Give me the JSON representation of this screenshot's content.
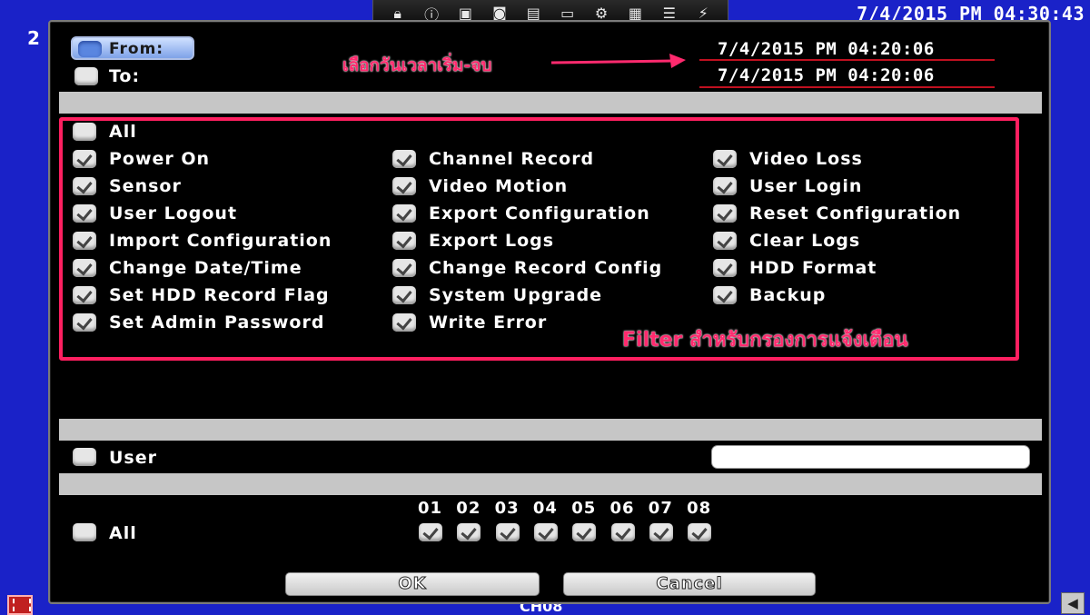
{
  "background": {
    "clock": "7/4/2015 PM 04:30:43",
    "left_digit": "2",
    "channel": "CH08"
  },
  "toolbar": {
    "icons": [
      "lock-icon",
      "info-icon",
      "chat-icon",
      "camera-icon",
      "film-icon",
      "monitor-icon",
      "gears-icon",
      "image-icon",
      "list-icon",
      "network-icon"
    ]
  },
  "time_range": {
    "from_label": "From:",
    "to_label": "To:",
    "from_value": "7/4/2015 PM 04:20:06",
    "to_value": "7/4/2015 PM 04:20:06",
    "annotation": "เลือกวันเวลาเริ่ม-จบ"
  },
  "filter": {
    "all_label": "All",
    "annotation": "Filter สำหรับกรองการแจ้งเตือน",
    "columns": [
      [
        "Power On",
        "Sensor",
        "User Logout",
        "Import Configuration",
        "Change Date/Time",
        "Set HDD Record Flag",
        "Set Admin Password"
      ],
      [
        "Channel Record",
        "Video Motion",
        "Export Configuration",
        "Export Logs",
        "Change Record Config",
        "System Upgrade",
        "Write Error"
      ],
      [
        "Video Loss",
        "User Login",
        "Reset Configuration",
        "Clear Logs",
        "HDD Format",
        "Backup"
      ]
    ]
  },
  "user": {
    "label": "User",
    "value": ""
  },
  "channels": {
    "all_label": "All",
    "numbers": [
      "01",
      "02",
      "03",
      "04",
      "05",
      "06",
      "07",
      "08"
    ]
  },
  "buttons": {
    "ok": "OK",
    "cancel": "Cancel"
  },
  "colors": {
    "desktop": "#1a22c8",
    "dialog": "#000000",
    "annotation": "#ff2a6e",
    "section_bar": "#c6c6c6"
  }
}
